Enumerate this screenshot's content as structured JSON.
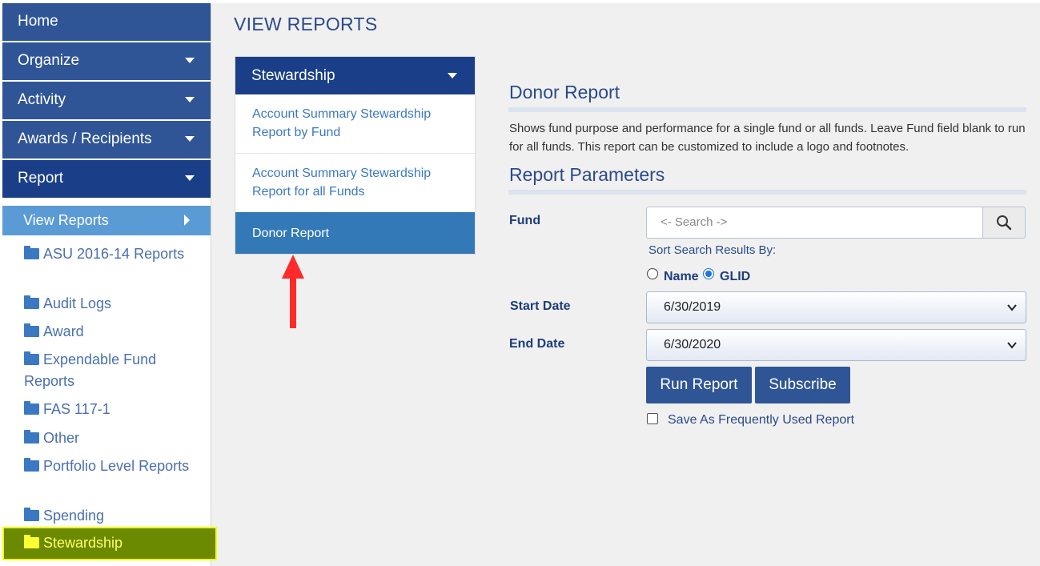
{
  "sidebar": {
    "nav": [
      {
        "label": "Home"
      },
      {
        "label": "Organize"
      },
      {
        "label": "Activity"
      },
      {
        "label": "Awards / Recipients"
      },
      {
        "label": "Report"
      }
    ],
    "view_reports": "View Reports",
    "folders": [
      {
        "label": "ASU 2016-14 Reports"
      },
      {
        "label": "Audit Logs"
      },
      {
        "label": "Award"
      },
      {
        "label": "Expendable Fund Reports"
      },
      {
        "label": "FAS 117-1"
      },
      {
        "label": "Other"
      },
      {
        "label": "Portfolio Level Reports"
      },
      {
        "label": "Spending"
      },
      {
        "label": "Stewardship"
      }
    ]
  },
  "main": {
    "title": "VIEW REPORTS",
    "category": {
      "header": "Stewardship",
      "items": [
        {
          "label": "Account Summary Stewardship Report by Fund"
        },
        {
          "label": "Account Summary Stewardship Report for all Funds"
        },
        {
          "label": "Donor Report"
        }
      ]
    },
    "report": {
      "title": "Donor Report",
      "description": "Shows fund purpose and performance for a single fund or all funds. Leave Fund field blank to run for all funds. This report can be customized to include a logo and footnotes.",
      "params_title": "Report Parameters",
      "fund_label": "Fund",
      "search_placeholder": "<- Search ->",
      "sort_label": "Sort Search Results By:",
      "sort_options": [
        "Name",
        "GLID"
      ],
      "sort_selected": "GLID",
      "start_label": "Start Date",
      "start_value": "6/30/2019",
      "end_label": "End Date",
      "end_value": "6/30/2020",
      "run_label": "Run Report",
      "subscribe_label": "Subscribe",
      "save_label": "Save As Frequently Used Report"
    }
  },
  "colors": {
    "nav_bg": "#2f5597",
    "nav_active": "#1a3f88",
    "sub_active": "#5b9bd5",
    "selected_item": "#3379b7",
    "highlight": "#f5ff00",
    "annotation_arrow": "#ff2b2b"
  }
}
